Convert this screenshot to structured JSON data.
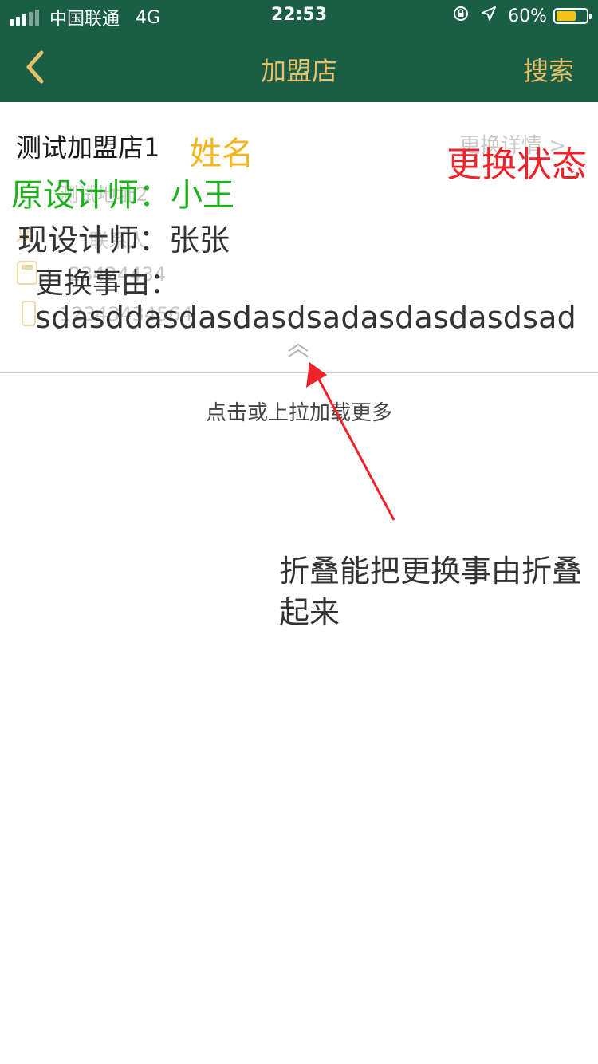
{
  "status_bar": {
    "carrier": "中国联通",
    "network": "4G",
    "time": "22:53",
    "battery": "60%",
    "battery_level": 0.6
  },
  "nav": {
    "title": "加盟店",
    "search_label": "搜索"
  },
  "card": {
    "store_name": "测试加盟店1",
    "detail_link": "更换详情 >",
    "ghost_address": "测试地址2",
    "ghost_contact": "联系人",
    "ghost_phone": "23424434",
    "ghost_mobile": "12343434564",
    "original_designer": "原设计师：小王",
    "current_designer": "现设计师：张张",
    "reason_label": "更换事由：",
    "reason_text": "sdasddasdasdasdsadasdasdasdsad"
  },
  "annotations": {
    "name": "姓名",
    "change_state": "更换状态",
    "collapse_note": "折叠能把更换事由折叠起来"
  },
  "footer": {
    "load_more": "点击或上拉加载更多"
  },
  "colors": {
    "nav_bg": "#1b5e46",
    "nav_text": "#e8bf6a",
    "annotation_red": "#f0222a",
    "annotation_green": "#1db11d",
    "annotation_yellow": "#f4b51a"
  }
}
